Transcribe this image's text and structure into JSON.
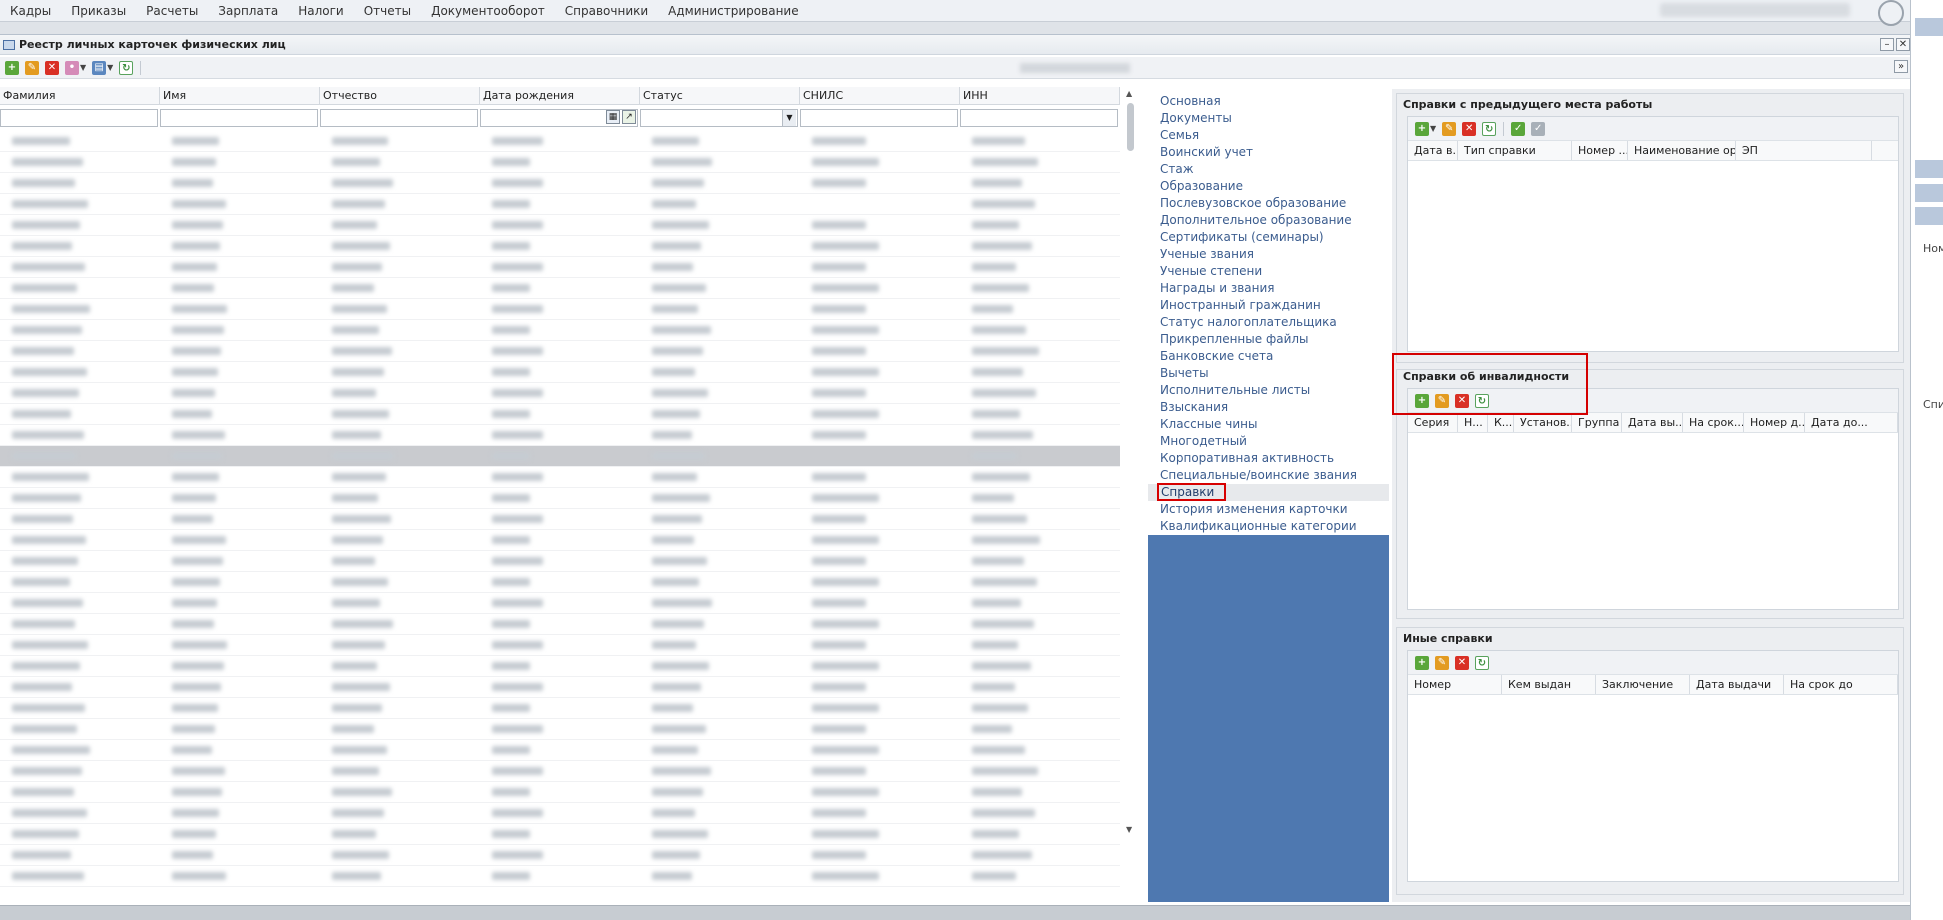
{
  "menu": {
    "items": [
      "Кадры",
      "Приказы",
      "Расчеты",
      "Зарплата",
      "Налоги",
      "Отчеты",
      "Документооборот",
      "Справочники",
      "Администрирование"
    ]
  },
  "window": {
    "title": "Реестр личных карточек физических лиц",
    "minimize": "–",
    "close": "✕",
    "expand": "»"
  },
  "grid": {
    "columns": [
      "Фамилия",
      "Имя",
      "Отчество",
      "Дата рождения",
      "Статус",
      "СНИЛС",
      "ИНН"
    ],
    "selected_row": 15,
    "row_count": 36
  },
  "nav": {
    "items": [
      "Основная",
      "Документы",
      "Семья",
      "Воинский учет",
      "Стаж",
      "Образование",
      "Послевузовское образование",
      "Дополнительное образование",
      "Сертификаты (семинары)",
      "Ученые звания",
      "Ученые степени",
      "Награды и звания",
      "Иностранный гражданин",
      "Статус налогоплательщика",
      "Прикрепленные файлы",
      "Банковские счета",
      "Вычеты",
      "Исполнительные листы",
      "Взыскания",
      "Классные чины",
      "Многодетный",
      "Корпоративная активность",
      "Специальные/воинские звания",
      "Справки",
      "История изменения карточки",
      "Квалификационные категории"
    ],
    "active_index": 23
  },
  "panels": {
    "prev_job": {
      "title": "Справки с предыдущего места работы",
      "columns": [
        "Дата в...",
        "Тип справки",
        "Номер ...",
        "Наименование ор...",
        "ЭП"
      ]
    },
    "disability": {
      "title": "Справки об инвалидности",
      "columns": [
        "Серия",
        "Н...",
        "К...",
        "Установ...",
        "Группа",
        "Дата вы...",
        "На срок...",
        "Номер д...",
        "Дата до..."
      ]
    },
    "other": {
      "title": "Иные справки",
      "columns": [
        "Номер",
        "Кем выдан",
        "Заключение",
        "Дата выдачи",
        "На срок до"
      ]
    }
  },
  "edge": {
    "labels": [
      "Ном",
      "Спи"
    ]
  },
  "colors": {
    "nav_background": "#4e78b0",
    "link": "#3b5c8e",
    "highlight": "#d40000"
  }
}
